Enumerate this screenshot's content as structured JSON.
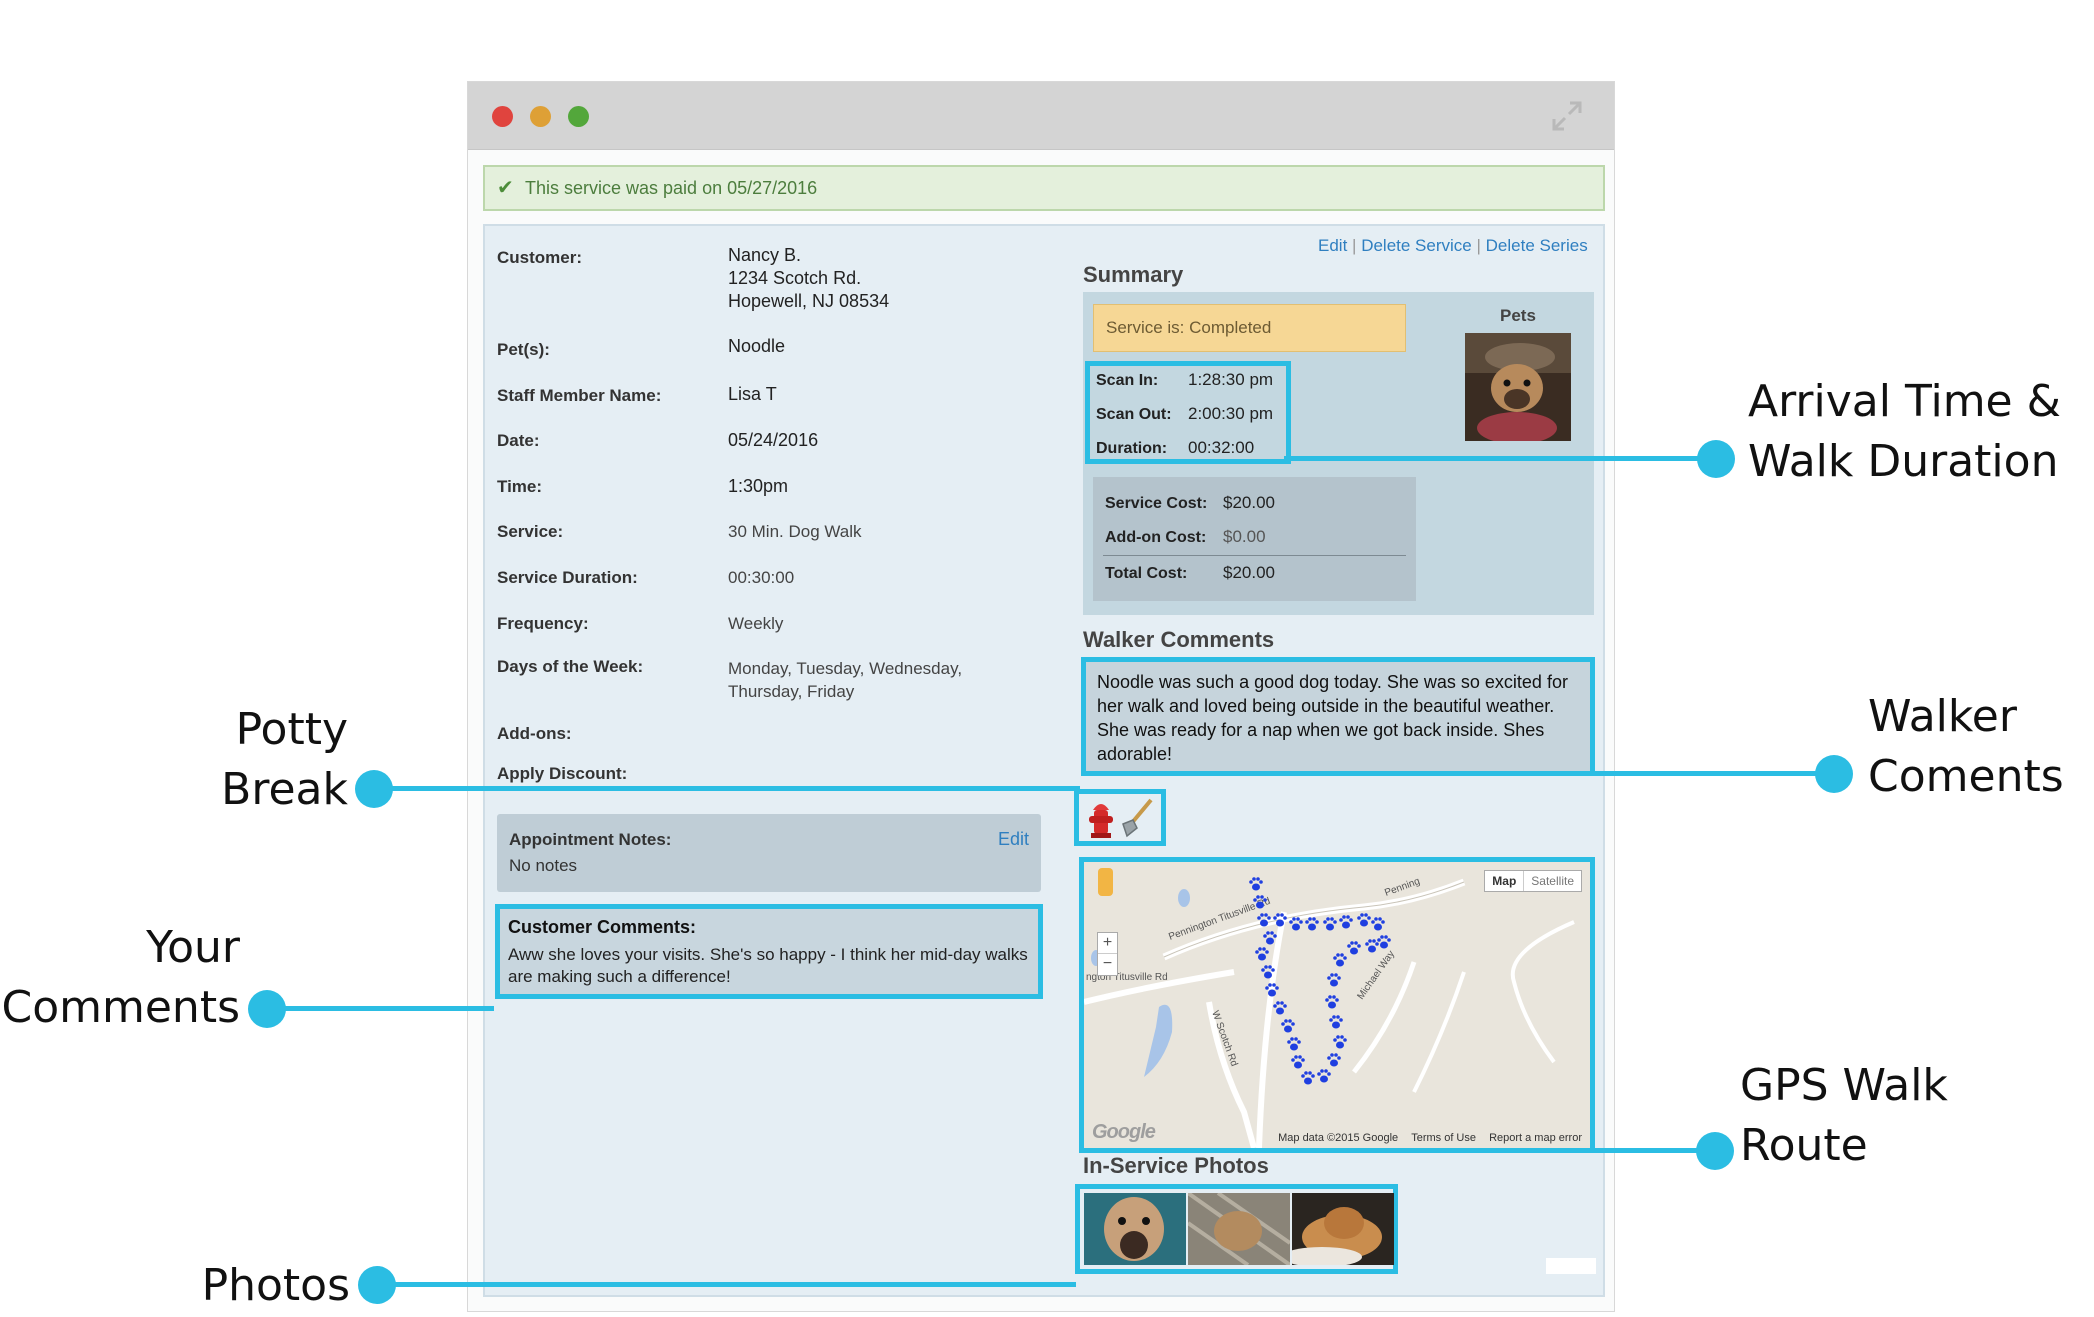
{
  "banner": {
    "icon": "check-icon",
    "text": "This service was paid on 05/27/2016"
  },
  "details": {
    "customer_label": "Customer:",
    "customer_name": "Nancy B.",
    "customer_street": "1234 Scotch Rd.",
    "customer_city": "Hopewell, NJ 08534",
    "pets_label": "Pet(s):",
    "pets_value": "Noodle",
    "staff_label": "Staff Member Name:",
    "staff_value": "Lisa T",
    "date_label": "Date:",
    "date_value": "05/24/2016",
    "time_label": "Time:",
    "time_value": "1:30pm",
    "service_label": "Service:",
    "service_value": "30 Min. Dog Walk",
    "duration_label": "Service Duration:",
    "duration_value": "00:30:00",
    "frequency_label": "Frequency:",
    "frequency_value": "Weekly",
    "days_label": "Days of the Week:",
    "days_value_line1": "Monday, Tuesday, Wednesday,",
    "days_value_line2": "Thursday, Friday",
    "addons_label": "Add-ons:",
    "discount_label": "Apply Discount:"
  },
  "appointment_notes": {
    "title": "Appointment Notes:",
    "edit": "Edit",
    "text": "No notes"
  },
  "customer_comments": {
    "title": "Customer Comments:",
    "text": "Aww she loves your visits. She's so happy - I think her mid-day walks are making such a difference!"
  },
  "actions": {
    "edit": "Edit",
    "delete_service": "Delete Service",
    "delete_series": "Delete Series",
    "separator": "|"
  },
  "summary": {
    "title": "Summary",
    "status": "Service is: Completed",
    "pets_label": "Pets",
    "scan_in_label": "Scan In:",
    "scan_in": "1:28:30 pm",
    "scan_out_label": "Scan Out:",
    "scan_out": "2:00:30 pm",
    "duration_label": "Duration:",
    "duration": "00:32:00",
    "service_cost_label": "Service Cost:",
    "service_cost": "$20.00",
    "addon_cost_label": "Add-on Cost:",
    "addon_cost": "$0.00",
    "total_cost_label": "Total Cost:",
    "total_cost": "$20.00"
  },
  "walker_comments": {
    "title": "Walker Comments",
    "text": "Noodle was such a good dog today. She was so excited for her walk and loved being outside in the beautiful weather. She was ready for a nap when we got back inside. Shes adorable!"
  },
  "potty": {
    "icons": [
      "fire-hydrant-icon",
      "shovel-icon"
    ]
  },
  "map": {
    "tab_map": "Map",
    "tab_satellite": "Satellite",
    "road_1": "Pennington Titusville Rd",
    "road_2": "ngton Titusville Rd",
    "road_3": "W Scotch Rd",
    "road_4": "Michael Way",
    "road_5": "Penning",
    "logo": "Google",
    "data_credit": "Map data ©2015 Google",
    "terms": "Terms of Use",
    "report": "Report a map error",
    "zoom_in": "+",
    "zoom_out": "−"
  },
  "photos": {
    "title": "In-Service Photos",
    "count": 3
  },
  "callouts": {
    "arrival_line1": "Arrival Time &",
    "arrival_line2": "Walk Duration",
    "walker_line1": "Walker",
    "walker_line2": "Coments",
    "gps_line1": "GPS Walk",
    "gps_line2": "Route",
    "potty_line1": "Potty",
    "potty_line2": "Break",
    "your_line1": "Your",
    "your_line2": "Comments",
    "photos": "Photos"
  },
  "colors": {
    "accent": "#2bbde3",
    "link": "#2f7fc0",
    "status_bg": "#f6d795",
    "paid_bg": "#e4f0dc"
  }
}
